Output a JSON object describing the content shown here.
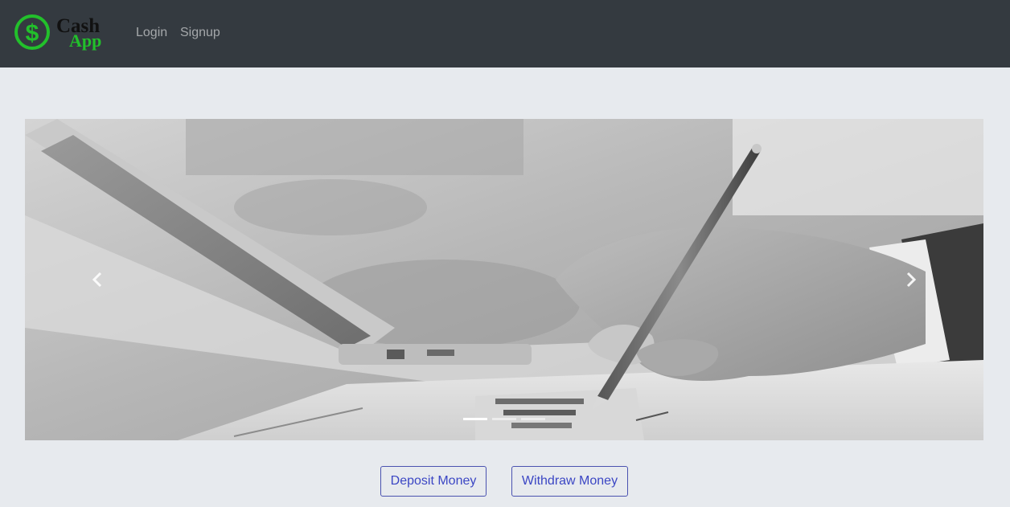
{
  "navbar": {
    "brand": {
      "logo_icon": "dollar-circle-icon",
      "line1": "Cash",
      "line2": "App",
      "colors": {
        "green": "#22c02b",
        "dark": "#111111"
      }
    },
    "links": [
      {
        "label": "Login"
      },
      {
        "label": "Signup"
      }
    ],
    "colors": {
      "background": "#343a40",
      "link": "#a7aaad"
    }
  },
  "carousel": {
    "prev_icon": "chevron-left-icon",
    "next_icon": "chevron-right-icon",
    "slide_count": 3,
    "active_slide": 1
  },
  "actions": {
    "deposit_label": "Deposit Money",
    "withdraw_label": "Withdraw Money",
    "color": "#3b46c4"
  },
  "page": {
    "background": "#e7eaee"
  }
}
